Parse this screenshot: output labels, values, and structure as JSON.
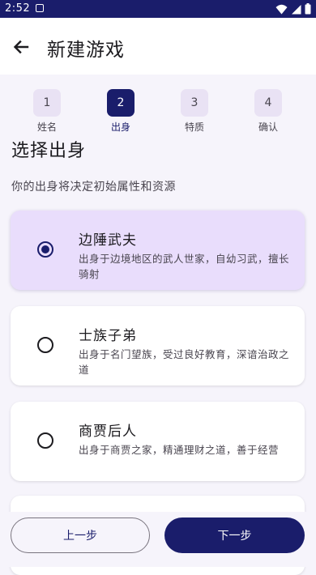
{
  "status_bar": {
    "time": "2:52",
    "notification_icon": "download-box-icon",
    "right_icons": [
      "wifi-icon",
      "signal-icon",
      "battery-icon"
    ]
  },
  "app_bar": {
    "title": "新建游戏",
    "back_icon": "arrow-left-icon"
  },
  "stepper": {
    "steps": [
      {
        "number": "1",
        "label": "姓名",
        "active": false
      },
      {
        "number": "2",
        "label": "出身",
        "active": true
      },
      {
        "number": "3",
        "label": "特质",
        "active": false
      },
      {
        "number": "4",
        "label": "确认",
        "active": false
      }
    ]
  },
  "section": {
    "title": "选择出身",
    "subtitle": "你的出身将决定初始属性和资源"
  },
  "options": [
    {
      "title": "边陲武夫",
      "description": "出身于边境地区的武人世家，自幼习武，擅长骑射",
      "selected": true
    },
    {
      "title": "士族子弟",
      "description": "出身于名门望族，受过良好教育，深谙治政之道",
      "selected": false
    },
    {
      "title": "商贾后人",
      "description": "出身于商贾之家，精通理财之道，善于经营",
      "selected": false
    }
  ],
  "footer": {
    "prev_label": "上一步",
    "next_label": "下一步"
  },
  "colors": {
    "primary": "#1a1d6b",
    "selected_card": "#e9ddfc",
    "step_inactive": "#e9e2f4",
    "background": "#f6f4fb",
    "status_bar": "#1a1d6b"
  }
}
